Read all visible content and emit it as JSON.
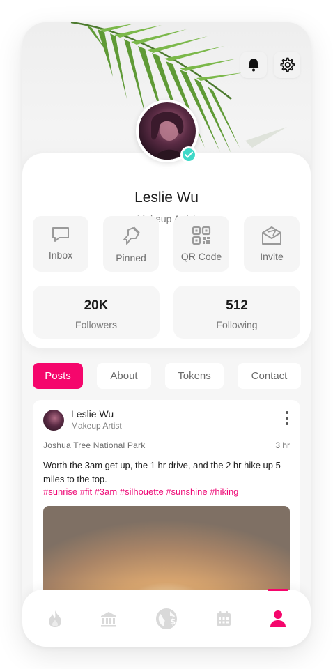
{
  "header": {
    "notifications_icon": "bell-icon",
    "settings_icon": "gear-icon"
  },
  "profile": {
    "name": "Leslie Wu",
    "role": "Makeup Artist",
    "verified": true
  },
  "actions": [
    {
      "label": "Inbox",
      "icon": "message-icon"
    },
    {
      "label": "Pinned",
      "icon": "pin-icon"
    },
    {
      "label": "QR Code",
      "icon": "qr-code-icon"
    },
    {
      "label": "Invite",
      "icon": "envelope-icon"
    }
  ],
  "stats": [
    {
      "value": "20K",
      "label": "Followers"
    },
    {
      "value": "512",
      "label": "Following"
    }
  ],
  "tabs": [
    {
      "label": "Posts",
      "active": true
    },
    {
      "label": "About",
      "active": false
    },
    {
      "label": "Tokens",
      "active": false
    },
    {
      "label": "Contact",
      "active": false
    }
  ],
  "post": {
    "author": "Leslie Wu",
    "author_role": "Makeup Artist",
    "location": "Joshua Tree National Park",
    "time": "3 hr",
    "text": "Worth the 3am get up, the 1 hr drive, and the 2 hr hike up 5 miles to the top.",
    "tags": "#sunrise #fit #3am #silhouette #sunshine #hiking"
  },
  "nav": [
    {
      "icon": "fire-icon",
      "active": false
    },
    {
      "icon": "bank-icon",
      "active": false
    },
    {
      "icon": "globe-dollar-icon",
      "active": false
    },
    {
      "icon": "calendar-icon",
      "active": false
    },
    {
      "icon": "user-icon",
      "active": true
    }
  ],
  "colors": {
    "accent": "#f5066c",
    "verified": "#3fd9c8",
    "nav_inactive": "#d9d9d9"
  }
}
